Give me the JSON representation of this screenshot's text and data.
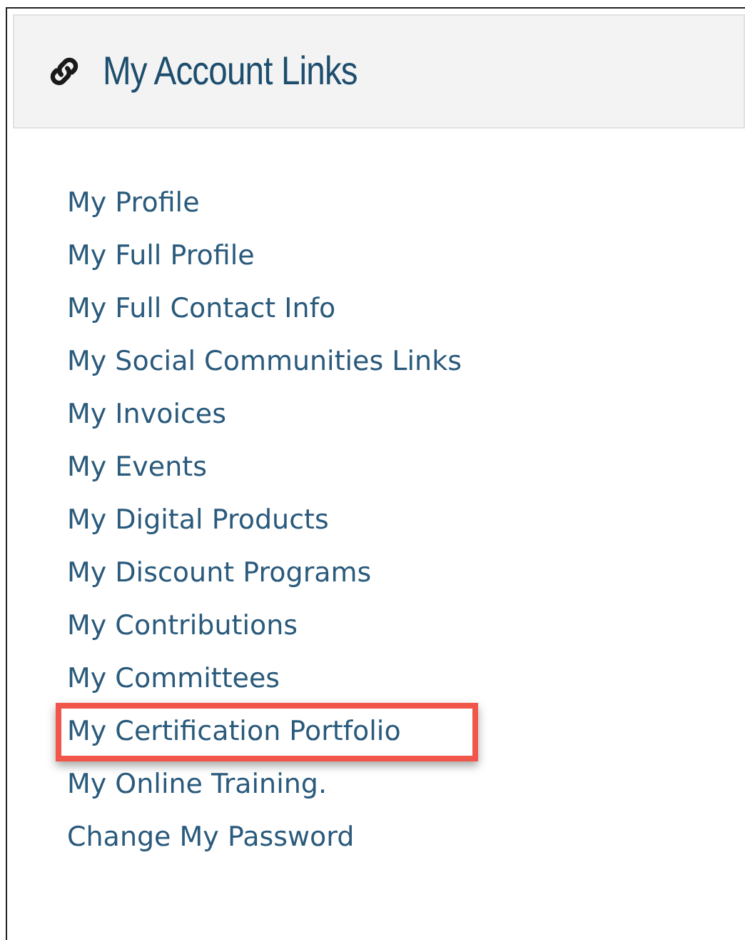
{
  "panel": {
    "title": "My Account Links"
  },
  "links": [
    {
      "label": "My Profile",
      "selected": false
    },
    {
      "label": "My Full Profile",
      "selected": false
    },
    {
      "label": "My Full Contact Info",
      "selected": false
    },
    {
      "label": "My Social Communities Links",
      "selected": false
    },
    {
      "label": "My Invoices",
      "selected": false
    },
    {
      "label": "My Events",
      "selected": false
    },
    {
      "label": "My Digital Products",
      "selected": false
    },
    {
      "label": "My Discount Programs",
      "selected": false
    },
    {
      "label": "My Contributions",
      "selected": false
    },
    {
      "label": "My Committees",
      "selected": false
    },
    {
      "label": "My Certification Portfolio",
      "selected": true
    },
    {
      "label": "My Online Training.",
      "selected": false
    },
    {
      "label": "Change My Password",
      "selected": false
    }
  ]
}
